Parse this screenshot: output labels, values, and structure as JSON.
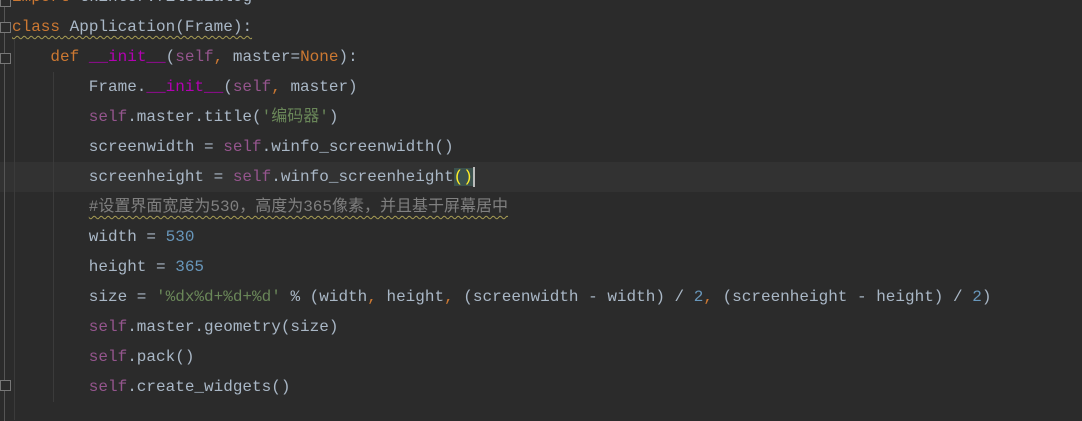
{
  "editor": {
    "lines": [
      {
        "indent": 0,
        "warn": false,
        "tokens": [
          [
            "import",
            "kw"
          ],
          [
            " tkinter.filedialog",
            "tx"
          ]
        ]
      },
      {
        "indent": 0,
        "warn": true,
        "tokens": [
          [
            "class",
            "kw"
          ],
          [
            " Application(Frame):",
            "tx"
          ]
        ]
      },
      {
        "indent": 4,
        "warn": false,
        "tokens": [
          [
            "def",
            "kw"
          ],
          [
            " ",
            "tx"
          ],
          [
            "__init__",
            "mg"
          ],
          [
            "(",
            "tx"
          ],
          [
            "self",
            "slf"
          ],
          [
            ",",
            "kw"
          ],
          [
            " master=",
            "tx"
          ],
          [
            "None",
            "kw"
          ],
          [
            "):",
            "tx"
          ]
        ]
      },
      {
        "indent": 8,
        "warn": false,
        "tokens": [
          [
            "Frame.",
            "tx"
          ],
          [
            "__init__",
            "mg"
          ],
          [
            "(",
            "tx"
          ],
          [
            "self",
            "slf"
          ],
          [
            ",",
            "kw"
          ],
          [
            " master)",
            "tx"
          ]
        ]
      },
      {
        "indent": 8,
        "warn": false,
        "tokens": [
          [
            "self",
            "slf"
          ],
          [
            ".master.title(",
            "tx"
          ],
          [
            "'编码器'",
            "str"
          ],
          [
            ")",
            "tx"
          ]
        ]
      },
      {
        "indent": 8,
        "warn": false,
        "tokens": [
          [
            "screenwidth = ",
            "tx"
          ],
          [
            "self",
            "slf"
          ],
          [
            ".winfo_screenwidth()",
            "tx"
          ]
        ]
      },
      {
        "indent": 8,
        "warn": false,
        "current": true,
        "tokens": [
          [
            "screenheight = ",
            "tx"
          ],
          [
            "self",
            "slf"
          ],
          [
            ".winfo_screenheight",
            "tx"
          ],
          [
            "()",
            "match"
          ]
        ]
      },
      {
        "indent": 8,
        "warn": true,
        "tokens": [
          [
            "#设置界面宽度为530，高度为365像素，并且基于屏幕居中",
            "cm"
          ]
        ]
      },
      {
        "indent": 8,
        "warn": false,
        "tokens": [
          [
            "width = ",
            "tx"
          ],
          [
            "530",
            "num"
          ]
        ]
      },
      {
        "indent": 8,
        "warn": false,
        "tokens": [
          [
            "height = ",
            "tx"
          ],
          [
            "365",
            "num"
          ]
        ]
      },
      {
        "indent": 8,
        "warn": false,
        "tokens": [
          [
            "size = ",
            "tx"
          ],
          [
            "'%dx%d+%d+%d'",
            "str"
          ],
          [
            " % (width",
            "tx"
          ],
          [
            ",",
            "kw"
          ],
          [
            " height",
            "tx"
          ],
          [
            ",",
            "kw"
          ],
          [
            " (screenwidth - width) / ",
            "tx"
          ],
          [
            "2",
            "num"
          ],
          [
            ",",
            "kw"
          ],
          [
            " (screenheight - height) / ",
            "tx"
          ],
          [
            "2",
            "num"
          ],
          [
            ")",
            "tx"
          ]
        ]
      },
      {
        "indent": 8,
        "warn": false,
        "tokens": [
          [
            "self",
            "slf"
          ],
          [
            ".master.geometry(size)",
            "tx"
          ]
        ]
      },
      {
        "indent": 8,
        "warn": false,
        "tokens": [
          [
            "self",
            "slf"
          ],
          [
            ".pack()",
            "tx"
          ]
        ]
      },
      {
        "indent": 8,
        "warn": false,
        "tokens": [
          [
            "self",
            "slf"
          ],
          [
            ".create_widgets()",
            "tx"
          ]
        ]
      }
    ]
  }
}
